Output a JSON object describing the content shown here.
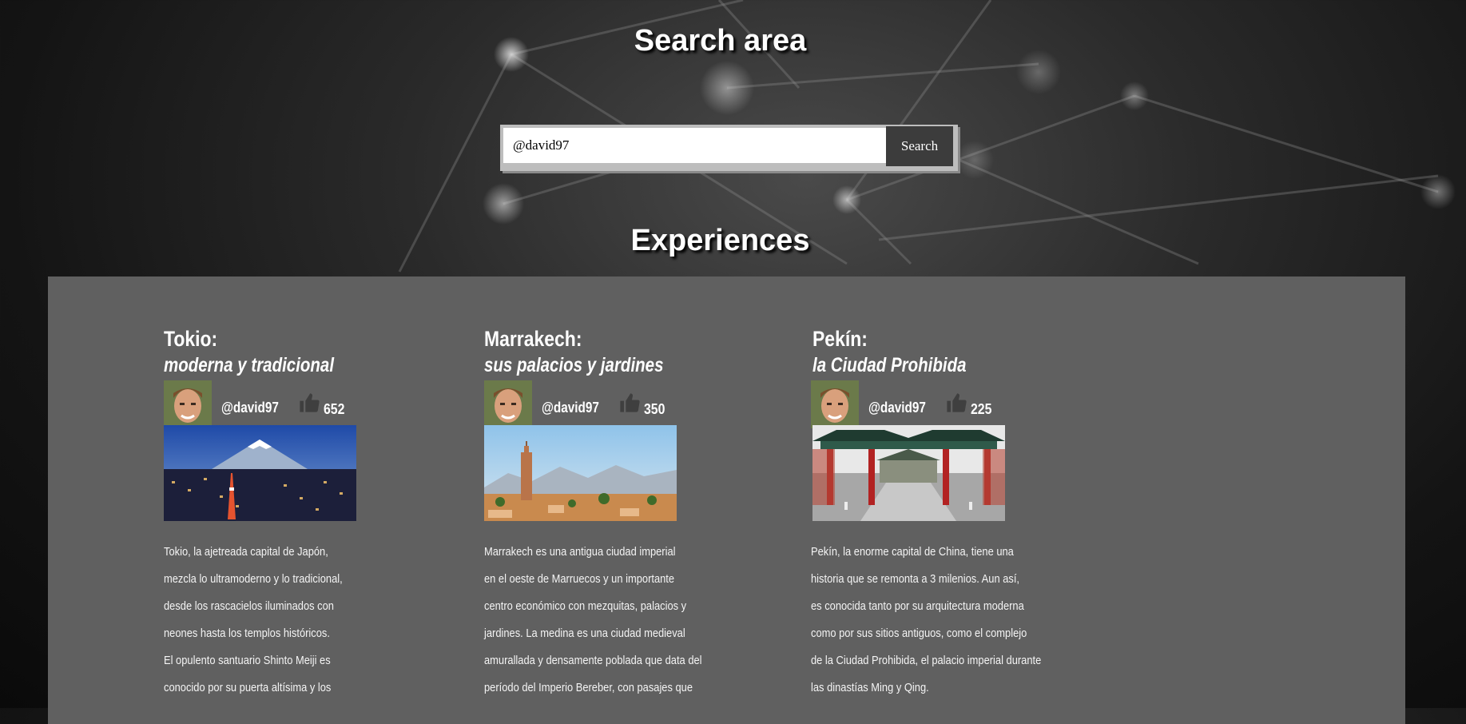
{
  "search": {
    "title": "Search area",
    "value": "@david97",
    "button_label": "Search"
  },
  "experiences": {
    "title": "Experiences",
    "cards": [
      {
        "title": "Tokio:",
        "subtitle": "moderna y tradicional",
        "username": "@david97",
        "likes": "652",
        "description": "Tokio, la ajetreada capital de Japón,\nmezcla lo ultramoderno y lo tradicional,\n desde los rascacielos iluminados con\nneones hasta los templos históricos.\nEl opulento santuario Shinto Meiji es\nconocido por su puerta altísima y los"
      },
      {
        "title": "Marrakech:",
        "subtitle": "sus palacios y jardines",
        "username": "@david97",
        "likes": "350",
        "description": "Marrakech es una antigua ciudad imperial\nen el oeste de Marruecos y un importante\ncentro económico con mezquitas, palacios y\njardines. La medina es una ciudad medieval\namurallada y densamente poblada que data del\nperíodo del Imperio Bereber, con pasajes que"
      },
      {
        "title": "Pekín:",
        "subtitle": "la Ciudad Prohibida",
        "username": "@david97",
        "likes": "225",
        "description": "Pekín, la enorme capital de China, tiene una\n historia que se remonta a 3 milenios. Aun así,\nes conocida tanto por su arquitectura moderna\ncomo por sus sitios antiguos, como el complejo\nde la Ciudad Prohibida, el palacio imperial durante\nlas dinastías Ming y Qing."
      }
    ]
  },
  "icons": {
    "like": "thumbs-up-icon",
    "avatar": "user-avatar"
  },
  "colors": {
    "panel": "#606060",
    "search_button": "#3c3c3c",
    "text": "#ffffff"
  }
}
